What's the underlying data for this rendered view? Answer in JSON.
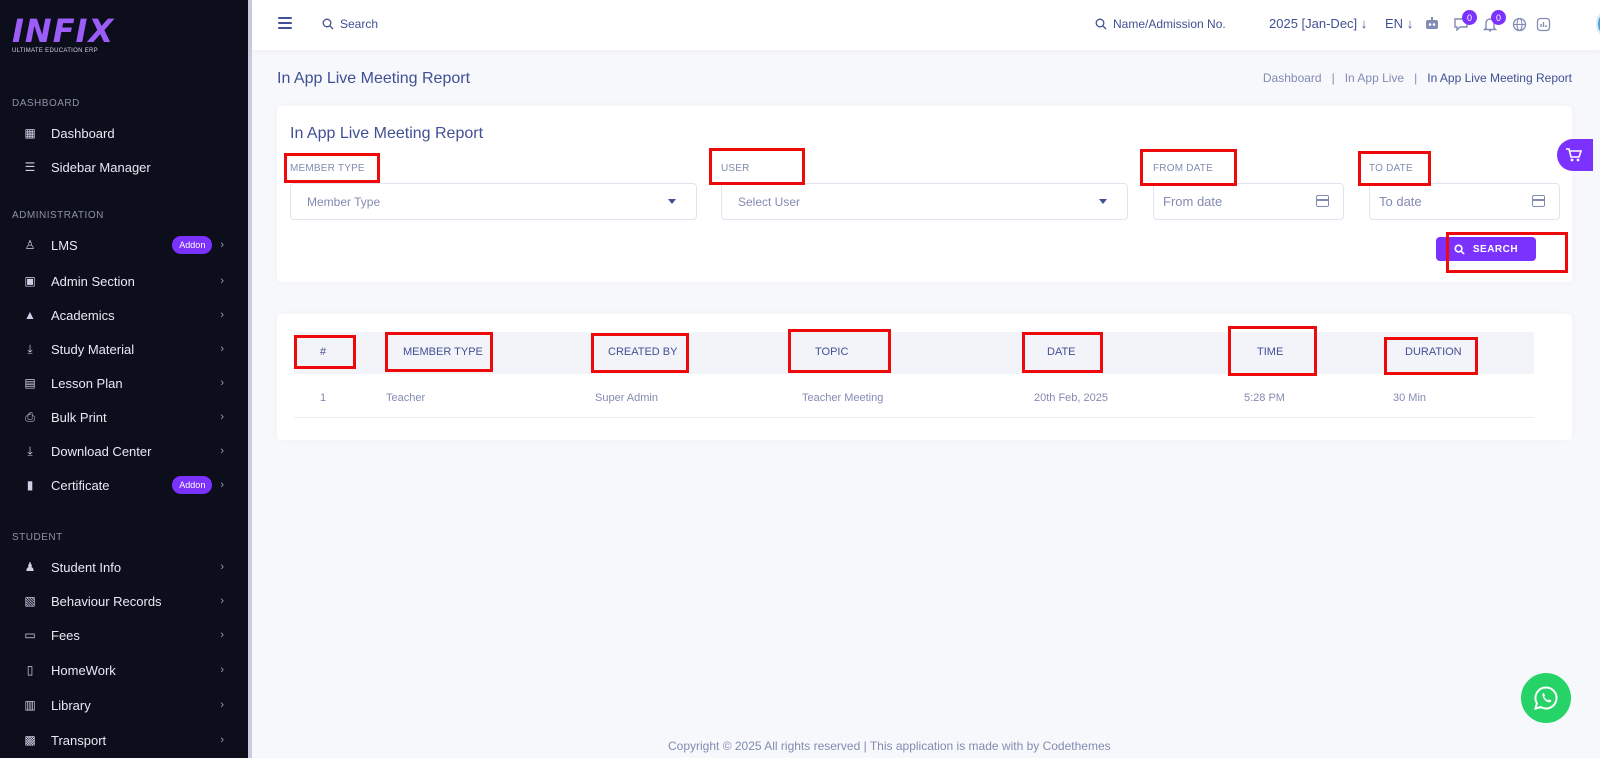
{
  "brand": {
    "logo_text": "INFIX",
    "logo_sub": "ULTIMATE EDUCATION ERP"
  },
  "sidebar": {
    "sections": [
      {
        "label": "DASHBOARD"
      },
      {
        "label": "ADMINISTRATION"
      },
      {
        "label": "STUDENT"
      }
    ],
    "items": [
      {
        "label": "Dashboard",
        "icon": "grid-icon"
      },
      {
        "label": "Sidebar Manager",
        "icon": "list-icon"
      },
      {
        "label": "LMS",
        "icon": "user-tie-icon",
        "badge": "Addon"
      },
      {
        "label": "Admin Section",
        "icon": "admin-icon"
      },
      {
        "label": "Academics",
        "icon": "graduation-cap-icon"
      },
      {
        "label": "Study Material",
        "icon": "download-icon"
      },
      {
        "label": "Lesson Plan",
        "icon": "lesson-icon"
      },
      {
        "label": "Bulk Print",
        "icon": "printer-icon"
      },
      {
        "label": "Download Center",
        "icon": "download-icon"
      },
      {
        "label": "Certificate",
        "icon": "book-icon",
        "badge": "Addon"
      },
      {
        "label": "Student Info",
        "icon": "student-icon"
      },
      {
        "label": "Behaviour Records",
        "icon": "records-icon"
      },
      {
        "label": "Fees",
        "icon": "money-icon"
      },
      {
        "label": "HomeWork",
        "icon": "book-open-icon"
      },
      {
        "label": "Library",
        "icon": "library-icon"
      },
      {
        "label": "Transport",
        "icon": "bus-icon"
      }
    ]
  },
  "topbar": {
    "search_label": "Search",
    "search2_label": "Name/Admission No.",
    "session": "2025 [Jan-Dec]",
    "language": "EN",
    "notif_count_1": "0",
    "notif_count_2": "0"
  },
  "page": {
    "title": "In App Live Meeting Report",
    "breadcrumb": [
      "Dashboard",
      "In App Live",
      "In App Live Meeting Report"
    ],
    "sep": "|"
  },
  "filter": {
    "title": "In App Live Meeting Report",
    "member_type_label": "MEMBER TYPE",
    "member_type_value": "Member Type",
    "user_label": "USER",
    "user_value": "Select User",
    "from_date_label": "FROM DATE",
    "from_date_placeholder": "From date",
    "to_date_label": "TO DATE",
    "to_date_placeholder": "To date",
    "search_button": "SEARCH"
  },
  "table": {
    "columns": [
      "#",
      "MEMBER TYPE",
      "CREATED BY",
      "TOPIC",
      "DATE",
      "TIME",
      "DURATION"
    ],
    "rows": [
      [
        "1",
        "Teacher",
        "Super Admin",
        "Teacher Meeting",
        "20th Feb, 2025",
        "5:28 PM",
        "30 Min"
      ]
    ]
  },
  "footer": {
    "text": "Copyright © 2025 All rights reserved | This application is made with by Codethemes"
  },
  "colors": {
    "accent": "#7c32ff",
    "sidebar_bg": "#0d0e1c",
    "text": "#415094",
    "highlight": "#ee0a0a",
    "whatsapp": "#25d366"
  }
}
